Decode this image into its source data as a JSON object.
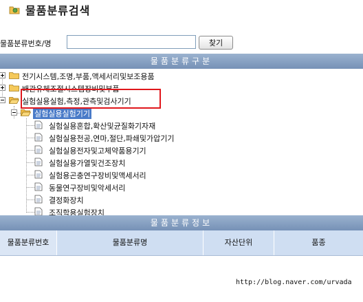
{
  "window": {
    "title": "물품분류검색"
  },
  "search": {
    "label": "물품분류번호/명",
    "value": "",
    "button_label": "찾기"
  },
  "tree_section": {
    "title": "물품분류구분"
  },
  "tree": {
    "top_items": [
      {
        "label": "전기시스템,조명,부품,액세서리및보조용품",
        "expanded": false
      },
      {
        "label": "배관유체조절시스템장비및부품",
        "expanded": false
      },
      {
        "label": "실험실용실험,측정,관측및검사기기",
        "expanded": true
      }
    ],
    "sub_item": {
      "label": "실험실용실험기기"
    },
    "leaves": [
      {
        "label": "실험실용혼합,확산및균질화기자재"
      },
      {
        "label": "실험실용천공,연마,절단,파쇄및가압기기"
      },
      {
        "label": "실험실용전자및고체약품용기기"
      },
      {
        "label": "실험실용가열및건조장치"
      },
      {
        "label": "실험용곤충연구장비및액세서리"
      },
      {
        "label": "동물연구장비및악세서리"
      },
      {
        "label": "결정화장치"
      },
      {
        "label": "조직학용실험장치"
      }
    ]
  },
  "info_section": {
    "title": "물품분류정보",
    "columns": [
      "물품분류번호",
      "물품분류명",
      "자산단위",
      "품종"
    ]
  },
  "watermark": {
    "text": "http://blog.naver.com/urvada"
  },
  "colors": {
    "header_bg": "#8aa3c4",
    "selection": "#4a7bc8",
    "annotation": "#e0161b"
  }
}
